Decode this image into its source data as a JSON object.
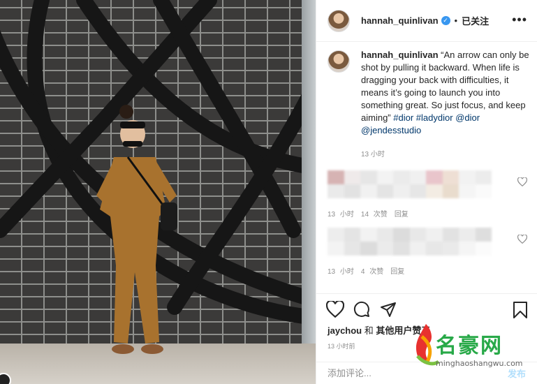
{
  "post": {
    "username": "hannah_quinlivan",
    "follow_state": "已关注",
    "separator": "•",
    "more_label": "•••"
  },
  "caption": {
    "username": "hannah_quinlivan",
    "text_before": " “An arrow can only be shot by pulling it backward. When life is dragging your back with difficulties, it means it’s going to launch you into something great. So just focus, and keep aiming” ",
    "tag1": "#dior",
    "tag2": "#ladydior",
    "mention1": "@dior",
    "mention2": "@jendesstudio",
    "time": "13 小时"
  },
  "comments": [
    {
      "time": "13 小时",
      "likes": "14 次赞",
      "reply": "回复"
    },
    {
      "time": "13 小时",
      "likes": "4 次赞",
      "reply": "回复"
    }
  ],
  "likes": {
    "user": "jaychou",
    "connector": " 和 ",
    "others": "其他用户",
    "suffix": "赞了"
  },
  "post_time": "13 小时前",
  "comment_box": {
    "placeholder": "添加评论...",
    "post_label": "发布"
  },
  "watermark": {
    "title": "名豪网",
    "url": "minghaoshangwu.com"
  },
  "icons": {
    "verified": "verified-badge-icon",
    "like": "heart-icon",
    "comment": "comment-bubble-icon",
    "share": "paper-plane-icon",
    "save": "bookmark-icon"
  },
  "colors": {
    "verified": "#3897f0",
    "link": "#00376b",
    "meta": "#8e8e8e",
    "post_button": "#b2dffc",
    "watermark": "#28a948"
  }
}
